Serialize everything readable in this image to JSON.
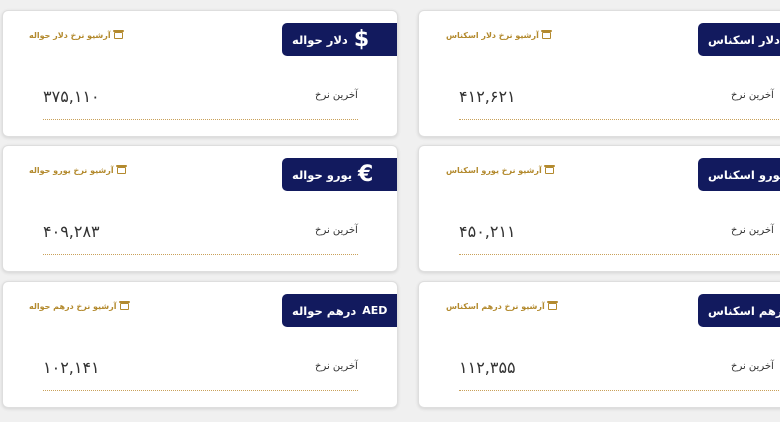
{
  "last_rate_label": "آخرین نرخ",
  "colors": {
    "badge_bg": "#121a5e",
    "archive_gold": "#b38a2e"
  },
  "cards": {
    "dollar_havaleh": {
      "title": "دلار حواله",
      "icon": "dollar-sign-icon",
      "symbol": "$",
      "archive": "آرشیو نرخ دلار حواله",
      "value": "۳۷۵,۱۱۰"
    },
    "dollar_eskenas": {
      "title": "دلار اسکناس",
      "archive": "آرشیو نرخ دلار اسکناس",
      "value": "۴۱۲,۶۲۱"
    },
    "euro_havaleh": {
      "title": "یورو حواله",
      "icon": "euro-sign-icon",
      "symbol": "€",
      "archive": "آرشیو نرخ یورو حواله",
      "value": "۴۰۹,۲۸۳"
    },
    "euro_eskenas": {
      "title": "یورو اسکناس",
      "archive": "آرشیو نرخ یورو اسکناس",
      "value": "۴۵۰,۲۱۱"
    },
    "dirham_havaleh": {
      "title": "درهم حواله",
      "code": "AED",
      "archive": "آرشیو نرخ درهم حواله",
      "value": "۱۰۲,۱۴۱"
    },
    "dirham_eskenas": {
      "title": "درهم اسکناس",
      "archive": "آرشیو نرخ درهم اسکناس",
      "value": "۱۱۲,۳۵۵"
    }
  }
}
